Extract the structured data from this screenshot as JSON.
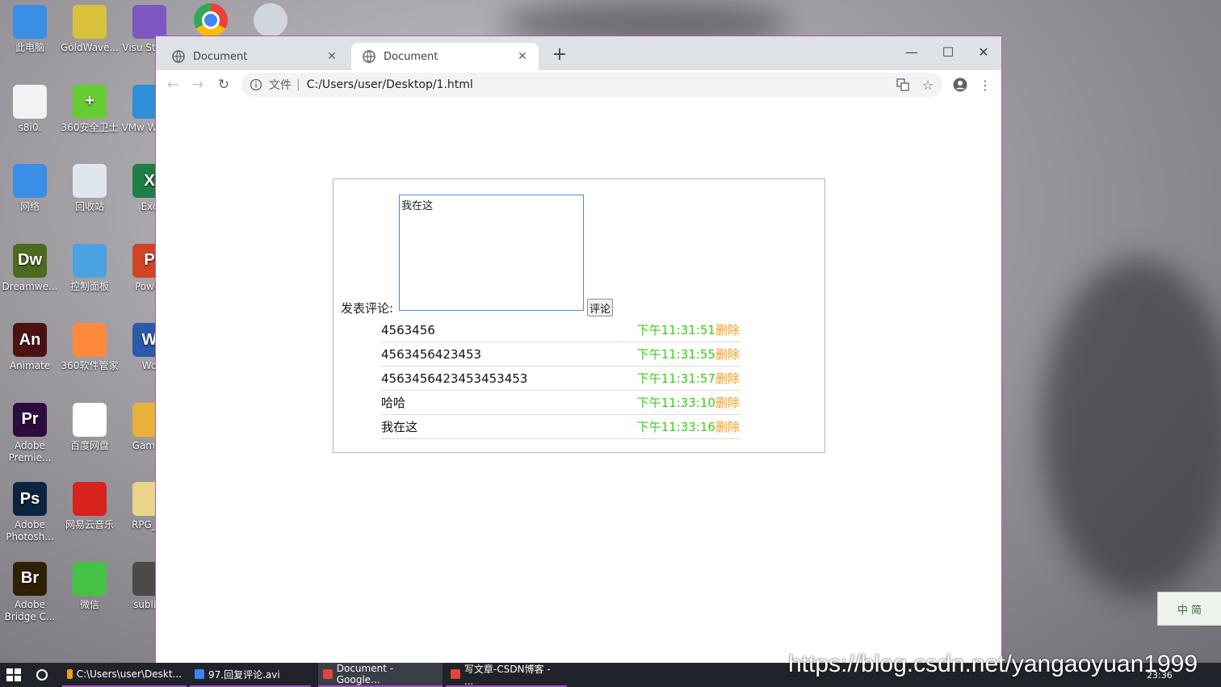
{
  "desktop": {
    "icons": [
      {
        "label": "此电脑",
        "color": "#3a8ee6",
        "glyph": ""
      },
      {
        "label": "GoldWave...",
        "color": "#d9c23b",
        "glyph": ""
      },
      {
        "label": "Visu Studio",
        "color": "#7e57c2",
        "glyph": ""
      },
      {
        "label": "s8i0.",
        "color": "#f2f2f2",
        "glyph": ""
      },
      {
        "label": "360安全卫士",
        "color": "#66cc33",
        "glyph": "+"
      },
      {
        "label": "VMw Works",
        "color": "#2d8fd5",
        "glyph": ""
      },
      {
        "label": "网络",
        "color": "#3a8ee6",
        "glyph": ""
      },
      {
        "label": "回收站",
        "color": "#dfe6ee",
        "glyph": ""
      },
      {
        "label": "Exc",
        "color": "#1e7e45",
        "glyph": "X"
      },
      {
        "label": "Dreamwe...",
        "color": "#4b6b1f",
        "glyph": "Dw"
      },
      {
        "label": "控制面板",
        "color": "#4aa3e0",
        "glyph": ""
      },
      {
        "label": "Power",
        "color": "#d04525",
        "glyph": "P"
      },
      {
        "label": "Animate",
        "color": "#4c1212",
        "glyph": "An"
      },
      {
        "label": "360软件管家",
        "color": "#ff8a3c",
        "glyph": ""
      },
      {
        "label": "Wo",
        "color": "#2b5aa8",
        "glyph": "W"
      },
      {
        "label": "Adobe Premie...",
        "color": "#2c0c3f",
        "glyph": "Pr"
      },
      {
        "label": "百度网盘",
        "color": "#ffffff",
        "glyph": ""
      },
      {
        "label": "GameF",
        "color": "#e8b23a",
        "glyph": ""
      },
      {
        "label": "Adobe Photosh...",
        "color": "#0b2540",
        "glyph": "Ps"
      },
      {
        "label": "网易云音乐",
        "color": "#d8231d",
        "glyph": ""
      },
      {
        "label": "RPG_Fa",
        "color": "#e9d48a",
        "glyph": ""
      },
      {
        "label": "Adobe Bridge C...",
        "color": "#2f2008",
        "glyph": "Br"
      },
      {
        "label": "微信",
        "color": "#46c242",
        "glyph": ""
      },
      {
        "label": "sublim",
        "color": "#4a4a4a",
        "glyph": ""
      }
    ],
    "taskbar_top_icons": [
      "chrome-icon",
      "app-icon"
    ],
    "corner_badge": "中 简"
  },
  "browser": {
    "tabs": [
      {
        "title": "Document",
        "active": false
      },
      {
        "title": "Document",
        "active": true
      }
    ],
    "new_tab": "+",
    "address": {
      "scheme_label": "文件",
      "separator": "|",
      "url": "C:/Users/user/Desktop/1.html"
    },
    "window_controls": {
      "minimize": "—",
      "maximize": "☐",
      "close": "✕"
    }
  },
  "page": {
    "post_label": "发表评论:",
    "textarea_value": "我在这",
    "submit_label": "评论",
    "comments": [
      {
        "text": "4563456",
        "time": "下午11:31:51",
        "delete": "删除"
      },
      {
        "text": "4563456423453",
        "time": "下午11:31:55",
        "delete": "删除"
      },
      {
        "text": "4563456423453453453",
        "time": "下午11:31:57",
        "delete": "删除"
      },
      {
        "text": "哈哈",
        "time": "下午11:33:10",
        "delete": "删除"
      },
      {
        "text": "我在这",
        "time": "下午11:33:16",
        "delete": "删除"
      }
    ]
  },
  "taskbar": {
    "items": [
      {
        "label": "C:\\Users\\user\\Deskt...",
        "color": "#e8a317"
      },
      {
        "label": "97.回复评论.avi",
        "color": "#3b82f6"
      },
      {
        "label": "Document - Google...",
        "color": "#e0463a"
      },
      {
        "label": "写文章-CSDN博客 - ...",
        "color": "#e0463a"
      }
    ],
    "clock": "23:36"
  },
  "overlay": {
    "url": "https://blog.csdn.net/yangaoyuan1999"
  }
}
